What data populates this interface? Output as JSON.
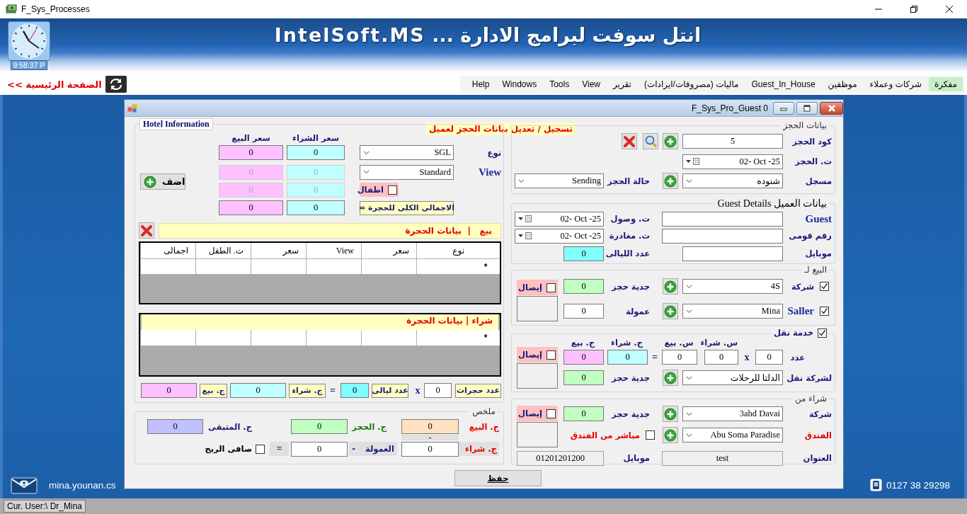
{
  "window": {
    "title": "F_Sys_Processes"
  },
  "banner": {
    "title": "انتل سوفت لبرامج الادارة ... IntelSoft.MS",
    "clock_time": "9:58:37 P"
  },
  "menu": {
    "home_link": "الصفحة الرئيسية >>",
    "items": [
      {
        "label": "مفكرة",
        "selected": true
      },
      {
        "label": "شركات وعملاء",
        "selected": false
      },
      {
        "label": "موظفين",
        "selected": false
      },
      {
        "label": "Guest_In_House",
        "selected": false
      },
      {
        "label": "ماليات (مصروفات/ايرادات)",
        "selected": false
      },
      {
        "label": "تقرير",
        "selected": false
      },
      {
        "label": "View",
        "selected": false
      },
      {
        "label": "Tools",
        "selected": false
      },
      {
        "label": "Windows",
        "selected": false
      },
      {
        "label": "Help",
        "selected": false
      }
    ]
  },
  "dialog": {
    "title": "F_Sys_Pro_Guest 0",
    "heading": "تسجيل / تعديل بيانات الحجز لعميل",
    "hotel": {
      "title": "Hotel Information",
      "buy_header": "سعر الشراء",
      "sell_header": "سعر البيع",
      "type": {
        "label": "نوع",
        "value": "SGL"
      },
      "view": {
        "label": "View",
        "value": "Standard"
      },
      "children": {
        "label": "اطفال",
        "checked": false
      },
      "room_total_label": "الاجمالى الكلى للحجرة =",
      "prices": [
        {
          "buy": "0",
          "sell": "0",
          "disabled": false
        },
        {
          "buy": "0",
          "sell": "0",
          "disabled": true
        },
        {
          "buy": "0",
          "sell": "0",
          "disabled": true
        },
        {
          "buy": "0",
          "sell": "0",
          "disabled": false
        }
      ],
      "add_button": "اضف",
      "sale_bar": "بيع   |  بيانات الحجرة",
      "sale_grid": {
        "columns": [
          "نوع",
          "سعر",
          "View",
          "سعر",
          "ت. الطفل",
          "اجمالى"
        ],
        "new_row_mark": "*"
      },
      "buy_grid": {
        "caption": "شراء | بيانات الحجرة",
        "new_row_mark": "*"
      },
      "totals": {
        "rooms_label": "عدد حجرات",
        "rooms": "0",
        "times": "x",
        "nights_label": "عدد ليالى",
        "nights": "0",
        "equals": "=",
        "buy_label": "ج. شراء",
        "buy": "0",
        "sell_label": "ج. بيع",
        "sell": "0"
      }
    },
    "summary": {
      "title": "ملخص",
      "sell_label": "ج. البيع",
      "sell": "0",
      "deposit_label": "ج. الحجز",
      "deposit": "0",
      "remaining_label": "ج. المتبقى",
      "remaining": "0",
      "minus": "-",
      "buy_label": "ج. شراء",
      "buy": "0",
      "minus_2": "-",
      "commission_label": "العمولة",
      "commission": "0",
      "equals": "=",
      "net_profit": {
        "label": "صافى الربح",
        "checked": false
      }
    },
    "booking": {
      "title": "بيانات الحجز",
      "code": {
        "label": "كود الحجز",
        "value": "5"
      },
      "date": {
        "label": "ت. الحجز",
        "value": "02- Oct -25"
      },
      "registrar": {
        "label": "مسجل",
        "value": "شنوده"
      },
      "status": {
        "label": "حالة الحجز",
        "value": "Sending"
      }
    },
    "guest": {
      "title": "بيانات العميل Guest Details",
      "name": {
        "label": "Guest"
      },
      "national_id": {
        "label": "رقم قومى"
      },
      "mobile": {
        "label": "موبايل"
      },
      "arrival": {
        "label": "ت. وصول",
        "value": "02- Oct -25"
      },
      "departure": {
        "label": "ت. مغادرة",
        "value": "02- Oct -25"
      },
      "nights": {
        "label": "عدد الليالى",
        "value": "0"
      }
    },
    "sale_to": {
      "title": "البيع لـ",
      "company": {
        "label": "شركة",
        "checked": true,
        "value": "4S"
      },
      "seller": {
        "label": "Saller",
        "checked": true,
        "value": "Mina"
      },
      "deposit": {
        "label": "جدية حجز",
        "value": "0"
      },
      "commission": {
        "label": "عمولة",
        "value": "0"
      },
      "receipt": {
        "label": "إيصال",
        "checked": false
      }
    },
    "transport": {
      "title": "خدمة نقل",
      "checked": true,
      "count_label": "عدد",
      "count": "0",
      "times": "x",
      "unit_buy_label": "س. شراء",
      "unit_buy": "0",
      "unit_sell_label": "س. بيع",
      "unit_sell": "0",
      "equals": "=",
      "total_buy_label": "ج. شراء",
      "total_buy": "0",
      "total_sell_label": "ج. بيع",
      "total_sell": "0",
      "company": {
        "label": "لشركة نقل",
        "value": "الدلتا للرحلات"
      },
      "deposit": {
        "label": "جدية حجز",
        "value": "0"
      },
      "receipt": {
        "label": "إيصال",
        "checked": false
      }
    },
    "purchase_from": {
      "title": "شراء من",
      "company": {
        "label": "شركة",
        "value": "3ahd Davai"
      },
      "hotel": {
        "label": "الفندق",
        "value": "Abu Soma Paradise"
      },
      "direct": {
        "label": "مباشر من الفندق",
        "checked": false
      },
      "deposit": {
        "label": "جدية حجز",
        "value": "0"
      },
      "receipt": {
        "label": "إيصال",
        "checked": false
      },
      "address": {
        "label": "العنوان",
        "value": "test"
      },
      "mobile": {
        "label": "موبايل",
        "value": "01201201200"
      }
    },
    "save_button": "حفظ"
  },
  "footer": {
    "email": "mina.younan.cs",
    "phone": "0127 38 29298"
  },
  "status_bar": {
    "user": "Cur. User:\\ Dr_Mina"
  }
}
